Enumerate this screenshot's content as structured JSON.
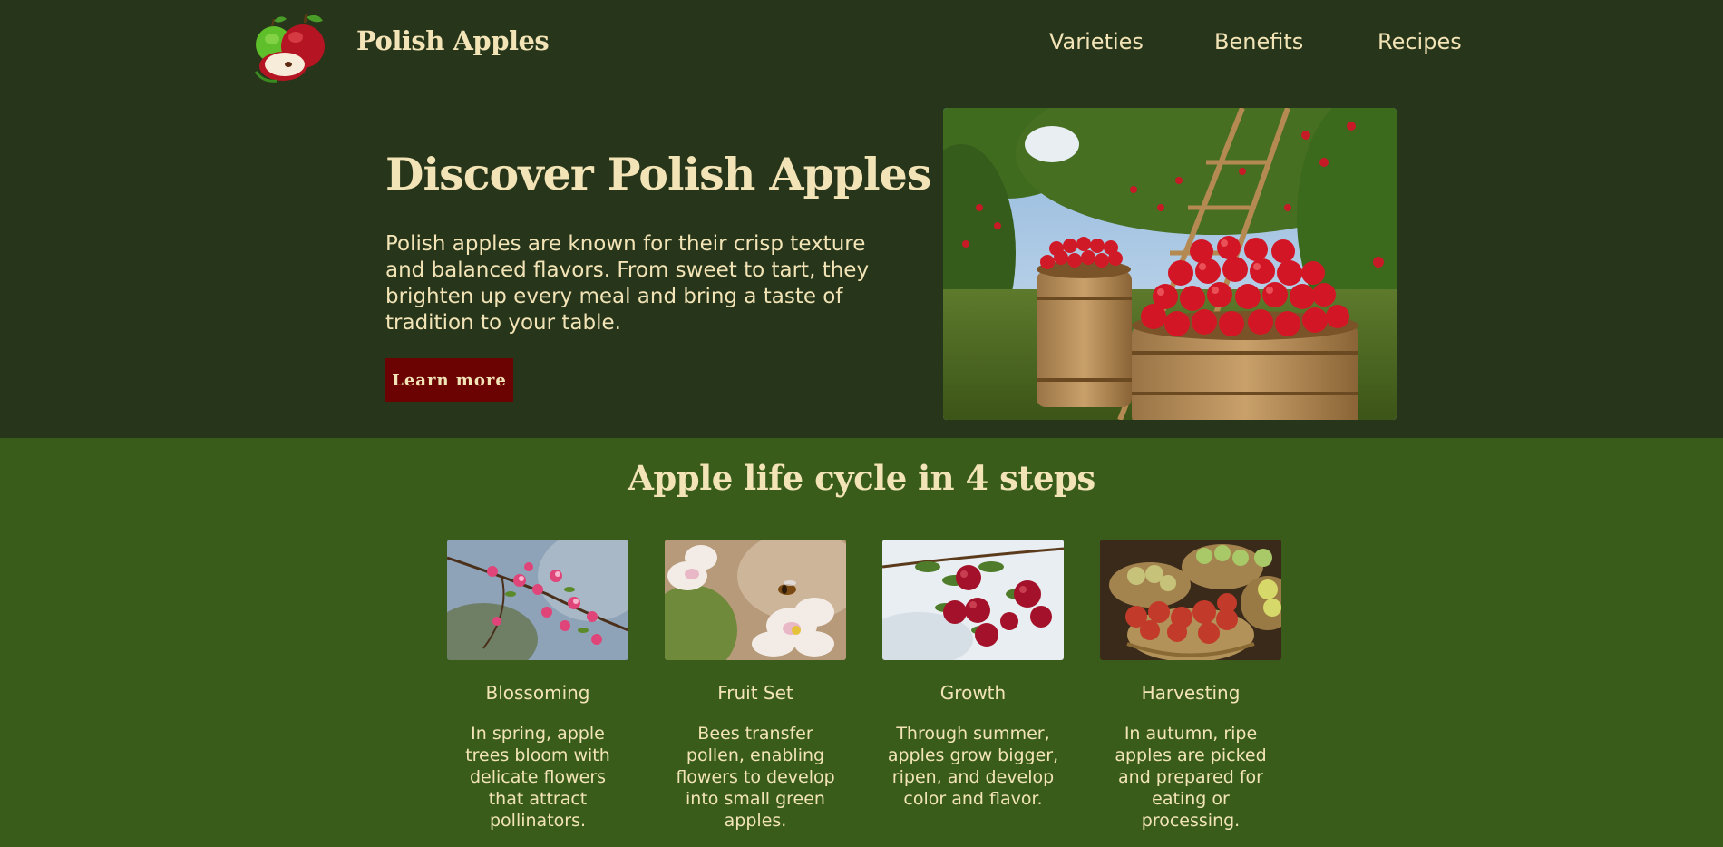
{
  "brand": {
    "name": "Polish Apples",
    "logo_icon": "apples-logo-icon"
  },
  "nav": {
    "items": [
      {
        "label": "Varieties"
      },
      {
        "label": "Benefits"
      },
      {
        "label": "Recipes"
      }
    ]
  },
  "hero": {
    "title": "Discover Polish Apples",
    "text": "Polish apples are known for their crisp texture and balanced flavors. From sweet to tart, they brighten up every meal and bring a taste of tradition to your table.",
    "cta_label": "Learn more",
    "image": "apple-orchard-barrels-image"
  },
  "lifecycle": {
    "title": "Apple life cycle in 4 steps",
    "steps": [
      {
        "name": "Blossoming",
        "desc": "In spring, apple trees bloom with delicate flowers that attract pollinators.",
        "image": "apple-blossom-image"
      },
      {
        "name": "Fruit Set",
        "desc": "Bees transfer pollen, enabling flowers to develop into small green apples.",
        "image": "bee-on-blossom-image"
      },
      {
        "name": "Growth",
        "desc": "Through summer, apples grow bigger, ripen, and develop color and flavor.",
        "image": "apples-on-branch-image"
      },
      {
        "name": "Harvesting",
        "desc": "In autumn, ripe apples are picked and prepared for eating or processing.",
        "image": "apple-baskets-image"
      }
    ]
  },
  "colors": {
    "header_bg": "#27351a",
    "section_bg": "#3a5c1b",
    "text": "#f2e4b6",
    "button": "#6b0303"
  }
}
